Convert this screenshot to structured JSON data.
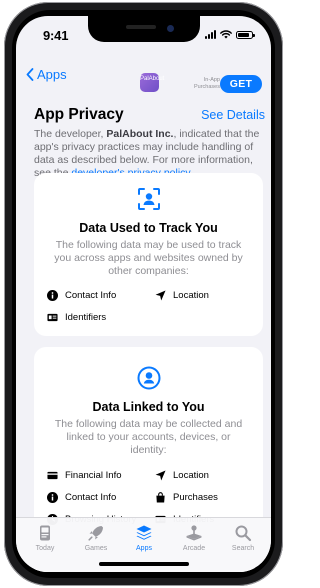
{
  "status": {
    "time": "9:41"
  },
  "nav": {
    "back_label": "Apps",
    "app_icon_text": "PalAbout",
    "in_app_label_1": "In-App",
    "in_app_label_2": "Purchases",
    "get_label": "GET"
  },
  "header": {
    "title": "App Privacy",
    "see_details": "See Details",
    "desc_prefix": "The developer, ",
    "developer": "PalAbout Inc.",
    "desc_middle": ", indicated that the app's privacy practices may include handling of data as described below. For more information, see the ",
    "policy_link": "developer's privacy policy",
    "desc_suffix": "."
  },
  "cards": [
    {
      "title": "Data Used to Track You",
      "desc": "The following data may be used to track you across apps and websites owned by other companies:",
      "items": [
        "Contact Info",
        "Location",
        "Identifiers"
      ]
    },
    {
      "title": "Data Linked to You",
      "desc": "The following data may be collected and linked to your accounts, devices, or identity:",
      "items": [
        "Financial Info",
        "Location",
        "Contact Info",
        "Purchases",
        "Browsing History",
        "Identifiers"
      ]
    }
  ],
  "tabs": [
    {
      "label": "Today",
      "icon": "today-icon"
    },
    {
      "label": "Games",
      "icon": "rocket-icon"
    },
    {
      "label": "Apps",
      "icon": "apps-stack-icon",
      "active": true
    },
    {
      "label": "Arcade",
      "icon": "joystick-icon"
    },
    {
      "label": "Search",
      "icon": "search-icon"
    }
  ],
  "colors": {
    "accent": "#0a7aff",
    "background": "#f2f2f7",
    "card": "#ffffff",
    "secondary_text": "#8e8e93"
  }
}
